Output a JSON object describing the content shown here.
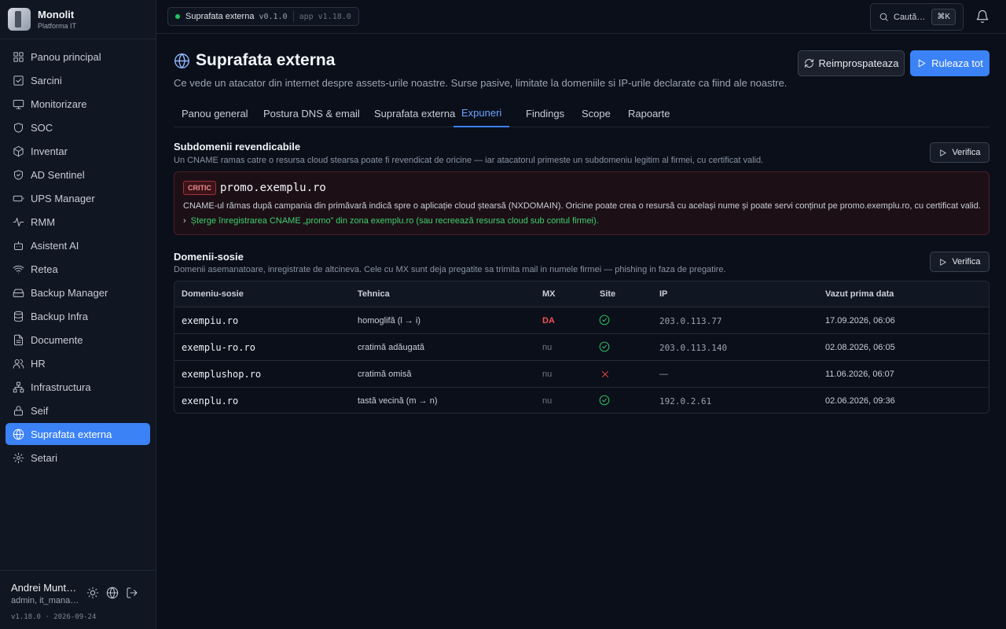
{
  "brand": {
    "title": "Monolit",
    "subtitle": "Platforma IT"
  },
  "sidebar": {
    "items": [
      {
        "label": "Panou principal",
        "icon": "grid-icon"
      },
      {
        "label": "Sarcini",
        "icon": "checkbox-icon"
      },
      {
        "label": "Monitorizare",
        "icon": "monitor-icon"
      },
      {
        "label": "SOC",
        "icon": "shield-icon"
      },
      {
        "label": "Inventar",
        "icon": "box-icon"
      },
      {
        "label": "AD Sentinel",
        "icon": "shield-check-icon"
      },
      {
        "label": "UPS Manager",
        "icon": "battery-icon"
      },
      {
        "label": "RMM",
        "icon": "activity-icon"
      },
      {
        "label": "Asistent AI",
        "icon": "bot-icon"
      },
      {
        "label": "Retea",
        "icon": "wifi-icon"
      },
      {
        "label": "Backup Manager",
        "icon": "hard-drive-icon"
      },
      {
        "label": "Backup Infra",
        "icon": "database-icon"
      },
      {
        "label": "Documente",
        "icon": "file-icon"
      },
      {
        "label": "HR",
        "icon": "users-icon"
      },
      {
        "label": "Infrastructura",
        "icon": "network-icon"
      },
      {
        "label": "Seif",
        "icon": "lock-icon"
      },
      {
        "label": "Suprafata externa",
        "icon": "globe-icon",
        "active": true
      },
      {
        "label": "Setari",
        "icon": "gear-icon"
      }
    ]
  },
  "user": {
    "name": "Andrei Munt…",
    "role": "admin, it_mana…",
    "version": "v1.18.0 · 2026-09-24"
  },
  "topbar": {
    "module": "Suprafata externa",
    "module_version": "v0.1.0",
    "app_version": "app v1.18.0",
    "search_placeholder": "Caută…",
    "search_shortcut": "⌘K"
  },
  "page": {
    "title": "Suprafata externa",
    "subtitle": "Ce vede un atacator din internet despre assets-urile noastre. Surse pasive, limitate la domeniile si IP-urile declarate ca fiind ale noastre.",
    "refresh_label": "Reimprospateaza",
    "run_label": "Ruleaza tot"
  },
  "tabs": [
    {
      "label": "Panou general"
    },
    {
      "label": "Postura DNS & email"
    },
    {
      "label": "Suprafata externa"
    },
    {
      "label": "Expuneri",
      "active": true
    },
    {
      "label": "Findings"
    },
    {
      "label": "Scope"
    },
    {
      "label": "Rapoarte"
    }
  ],
  "claimable": {
    "title": "Subdomenii revendicabile",
    "description": "Un CNAME ramas catre o resursa cloud stearsa poate fi revendicat de oricine — iar atacatorul primeste un subdomeniu legitim al firmei, cu certificat valid.",
    "verify_label": "Verifica",
    "alert": {
      "severity": "CRITIC",
      "domain": "promo.exemplu.ro",
      "text": "CNAME-ul rămas după campania din primăvară indică spre o aplicație cloud ștearsă (NXDOMAIN). Oricine poate crea o resursă cu același nume și poate servi conținut pe promo.exemplu.ro, cu certificat valid.",
      "fix": "Șterge înregistrarea CNAME „promo” din zona exemplu.ro (sau recreează resursa cloud sub contul firmei)."
    }
  },
  "lookalike": {
    "title": "Domenii-sosie",
    "description": "Domenii asemanatoare, inregistrate de altcineva. Cele cu MX sunt deja pregatite sa trimita mail in numele firmei — phishing in faza de pregatire.",
    "verify_label": "Verifica",
    "columns": [
      "Domeniu-sosie",
      "Tehnica",
      "MX",
      "Site",
      "IP",
      "Vazut prima data"
    ],
    "rows": [
      {
        "domain": "exempiu.ro",
        "technique": "homoglifă (l → i)",
        "mx": "DA",
        "site": true,
        "ip": "203.0.113.77",
        "first_seen": "17.09.2026, 06:06"
      },
      {
        "domain": "exemplu-ro.ro",
        "technique": "cratimă adăugată",
        "mx": "nu",
        "site": true,
        "ip": "203.0.113.140",
        "first_seen": "02.08.2026, 06:05"
      },
      {
        "domain": "exemplushop.ro",
        "technique": "cratimă omisă",
        "mx": "nu",
        "site": false,
        "ip": "—",
        "first_seen": "11.06.2026, 06:07"
      },
      {
        "domain": "exenplu.ro",
        "technique": "tastă vecină (m → n)",
        "mx": "nu",
        "site": true,
        "ip": "192.0.2.61",
        "first_seen": "02.06.2026, 09:36"
      }
    ]
  }
}
